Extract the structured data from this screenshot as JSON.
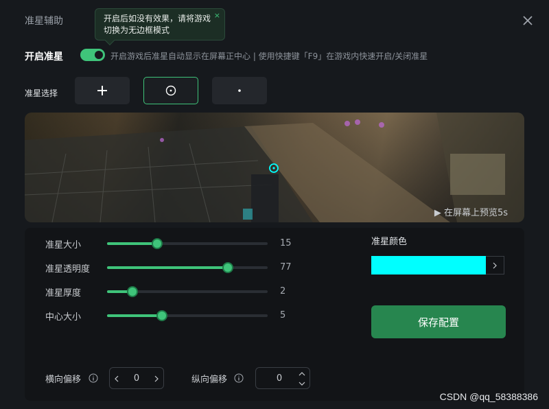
{
  "window": {
    "title": "准星辅助"
  },
  "tooltip": {
    "text": "开启后如没有效果，请将游戏切换为无边框模式",
    "close": "×"
  },
  "enable": {
    "label": "开启准星",
    "on": true,
    "description": "开启游戏后准星自动显示在屏幕正中心 | 使用快捷键「F9」在游戏内快速开启/关闭准星"
  },
  "crosshair_select": {
    "label": "准星选择",
    "options": [
      {
        "icon": "plus-crosshair-icon",
        "selected": false
      },
      {
        "icon": "circle-dot-crosshair-icon",
        "selected": true
      },
      {
        "icon": "dot-crosshair-icon",
        "selected": false
      }
    ]
  },
  "preview": {
    "hint": "在屏幕上预览5s"
  },
  "sliders": [
    {
      "label": "准星大小",
      "value": "15",
      "fraction": 0.31
    },
    {
      "label": "准星透明度",
      "value": "77",
      "fraction": 0.75
    },
    {
      "label": "准星厚度",
      "value": "2",
      "fraction": 0.16
    },
    {
      "label": "中心大小",
      "value": "5",
      "fraction": 0.34
    }
  ],
  "color": {
    "label": "准星颜色",
    "value": "#00ffff"
  },
  "save_label": "保存配置",
  "offsets": {
    "horizontal": {
      "label": "横向偏移",
      "value": "0"
    },
    "vertical": {
      "label": "纵向偏移",
      "value": "0"
    }
  },
  "watermark": "CSDN @qq_58388386",
  "colors": {
    "accent": "#3fc47a",
    "save": "#27864f",
    "background": "#16191d"
  }
}
